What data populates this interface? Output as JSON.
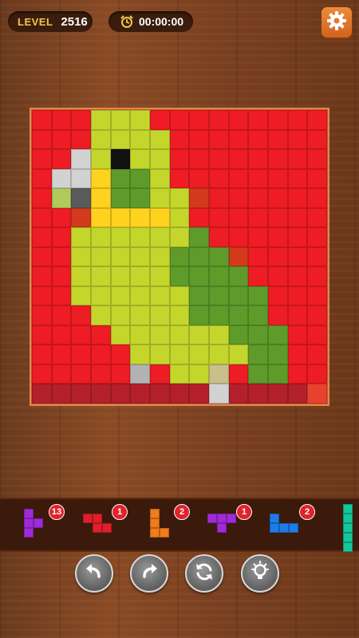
{
  "header": {
    "level_label": "LEVEL",
    "level_value": "2516",
    "timer_value": "00:00:00",
    "settings_icon": "gear-icon",
    "timer_icon": "alarm-clock-icon"
  },
  "board": {
    "cols": 15,
    "rows": 15,
    "palette": {
      "R": "#ee1c24",
      "r": "#d43a1c",
      "D": "#b3202b",
      "P": "#e8412e",
      "Y": "#c4d62c",
      "y": "#d6e04a",
      "G": "#5e9b2a",
      "g": "#76a83a",
      "E": "#ffd21f",
      "B": "#111111",
      "W": "#d2d2d2",
      "S": "#5a5a5a",
      "L": "#b2c95c",
      "T": "#c8bf8a",
      "K": "#b2b2b2"
    },
    "grid": [
      "RRRYYYRRRRRRRRR",
      "RRRYYYYRRRRRRRR",
      "RRWYBYYRRRRRRRR",
      "RWWEGGYRRRRRRRR",
      "RLSEGGYYrRRRRRR",
      "RRrEEEEYRRRRRRR",
      "RRYYYYYYGRRRRRR",
      "RRYYYYYGGGrRRRR",
      "RRYYYYYGGGGRRRR",
      "RRYYYYYYGGGGRRR",
      "RRRYYYYYGGGGRRR",
      "RRRRYYYYYYGGGRR",
      "RRRRRYYYYYYGGRR",
      "RRRRRKRYYTRGGRR",
      "DDDDDDDDDWDDDDP"
    ]
  },
  "tray": {
    "pieces": [
      {
        "name": "t-piece-purple",
        "color": "#a12ad8",
        "count": "13"
      },
      {
        "name": "z-piece-red",
        "color": "#e01f2a",
        "count": "1"
      },
      {
        "name": "l-piece-orange",
        "color": "#f07d1a",
        "count": "2"
      },
      {
        "name": "t-piece-purple-flat",
        "color": "#a12ad8",
        "count": "1"
      },
      {
        "name": "j-piece-blue",
        "color": "#1e7be8",
        "count": "2"
      },
      {
        "name": "i-piece-teal",
        "color": "#14c79a",
        "count": ""
      }
    ]
  },
  "controls": {
    "undo_icon": "undo-icon",
    "redo_icon": "redo-icon",
    "restart_icon": "restart-icon",
    "hint_icon": "lightbulb-icon"
  }
}
